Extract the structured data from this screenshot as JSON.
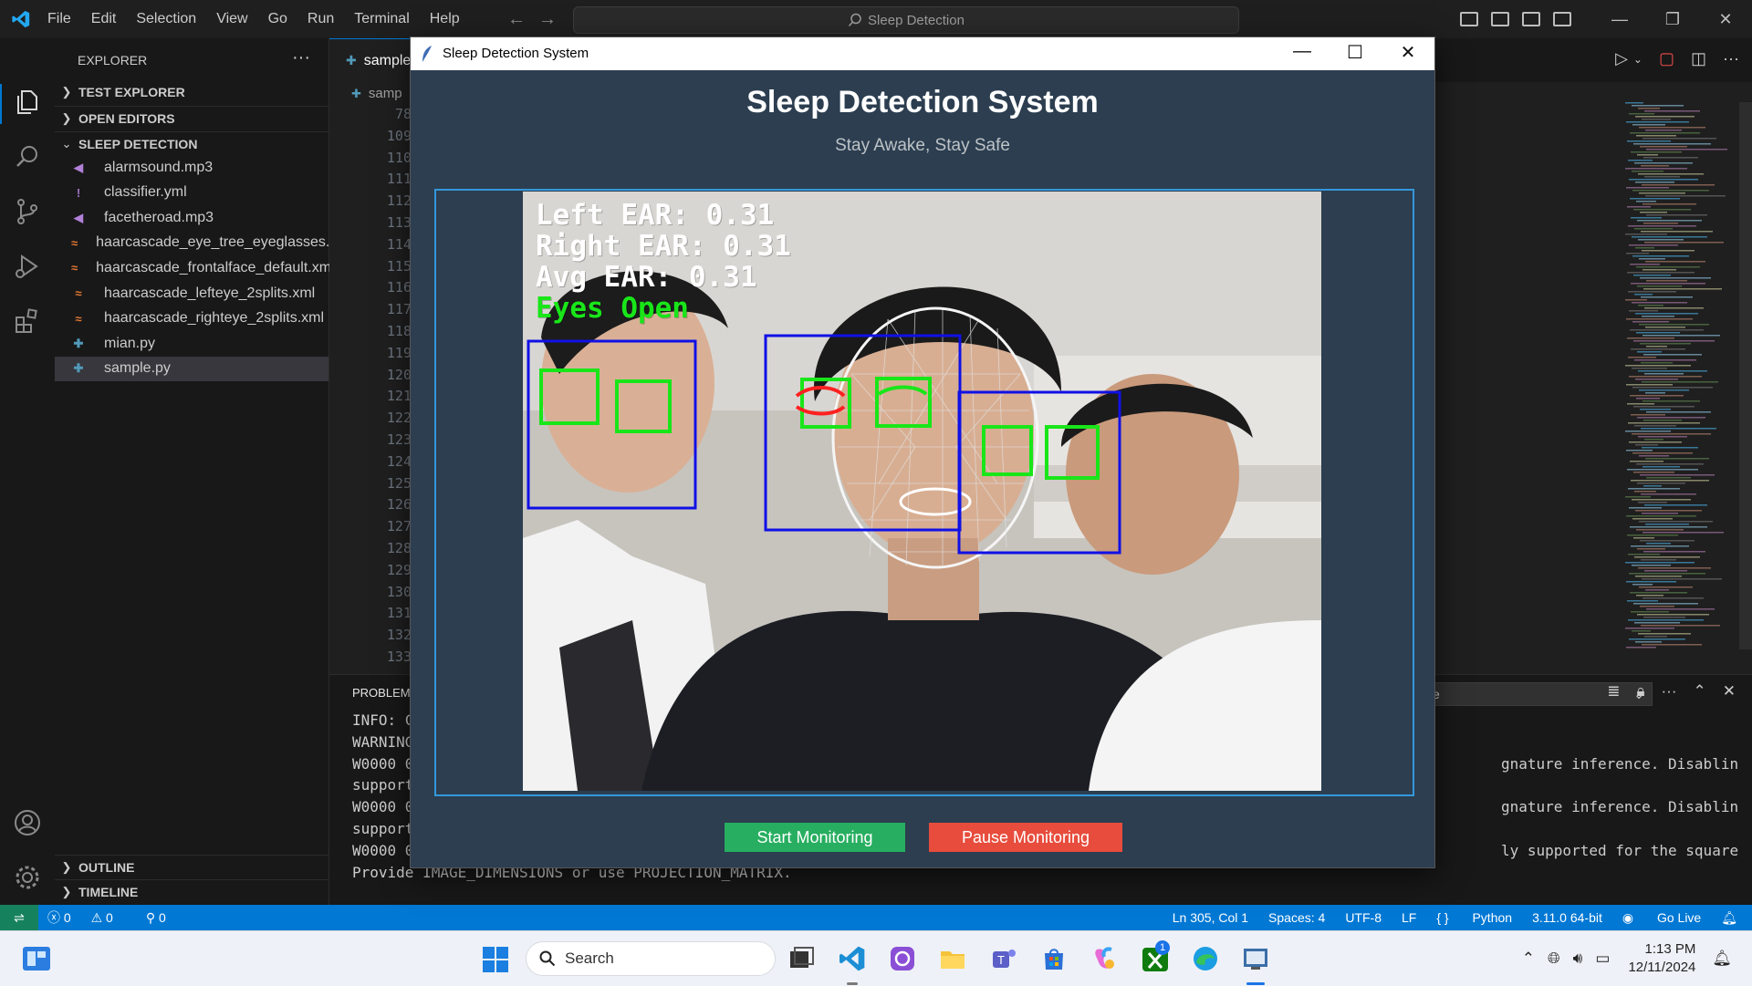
{
  "menu": [
    "File",
    "Edit",
    "Selection",
    "View",
    "Go",
    "Run",
    "Terminal",
    "Help"
  ],
  "command_center": "Sleep Detection",
  "explorer": {
    "title": "EXPLORER",
    "sections": {
      "test_explorer": "TEST EXPLORER",
      "open_editors": "OPEN EDITORS",
      "project": "SLEEP DETECTION",
      "outline": "OUTLINE",
      "timeline": "TIMELINE"
    },
    "files": [
      {
        "name": "alarmsound.mp3",
        "icon": "audio-icon",
        "glyph": "◀",
        "color": "#b180d7"
      },
      {
        "name": "classifier.yml",
        "icon": "yaml-icon",
        "glyph": "!",
        "color": "#a074c4"
      },
      {
        "name": "facetheroad.mp3",
        "icon": "audio-icon",
        "glyph": "◀",
        "color": "#b180d7"
      },
      {
        "name": "haarcascade_eye_tree_eyeglasses....",
        "icon": "rss-icon",
        "glyph": "≈",
        "color": "#e37933"
      },
      {
        "name": "haarcascade_frontalface_default.xml",
        "icon": "rss-icon",
        "glyph": "≈",
        "color": "#e37933"
      },
      {
        "name": "haarcascade_lefteye_2splits.xml",
        "icon": "rss-icon",
        "glyph": "≈",
        "color": "#e37933"
      },
      {
        "name": "haarcascade_righteye_2splits.xml",
        "icon": "rss-icon",
        "glyph": "≈",
        "color": "#e37933"
      },
      {
        "name": "mian.py",
        "icon": "python-icon",
        "glyph": "✚",
        "color": "#519aba"
      },
      {
        "name": "sample.py",
        "icon": "python-icon",
        "glyph": "✚",
        "color": "#519aba"
      }
    ]
  },
  "editor": {
    "tab": "sample",
    "breadcrumb": "samp",
    "line_numbers": [
      "78",
      "109",
      "110",
      "111",
      "112",
      "113",
      "114",
      "115",
      "116",
      "117",
      "118",
      "119",
      "120",
      "121",
      "122",
      "123",
      "124",
      "125",
      "126",
      "127",
      "128",
      "129",
      "130",
      "131",
      "132",
      "133"
    ]
  },
  "panel": {
    "tab": "PROBLEMS",
    "dropdown": "e",
    "terminal_left": [
      "INFO: C",
      "WARNING",
      "W0000 0",
      "support",
      "W0000 0",
      "support",
      "W0000 0",
      "Provide IMAGE_DIMENSIONS or use PROJECTION_MATRIX."
    ],
    "terminal_right": [
      "",
      "",
      "gnature inference. Disabling",
      "",
      "gnature inference. Disabling",
      "",
      "ly supported for the square ROI.",
      ""
    ]
  },
  "statusbar": {
    "errors": "0",
    "warnings": "0",
    "ports": "0",
    "position": "Ln 305, Col 1",
    "spaces": "Spaces: 4",
    "encoding": "UTF-8",
    "eol": "LF",
    "language": "Python",
    "interpreter": "3.11.0 64-bit",
    "golive": "Go Live"
  },
  "app": {
    "window_title": "Sleep Detection System",
    "heading": "Sleep Detection System",
    "subtitle": "Stay Awake, Stay Safe",
    "overlay": {
      "left_ear": "Left EAR: 0.31",
      "right_ear": "Right EAR: 0.31",
      "avg_ear": "Avg EAR: 0.31",
      "status": "Eyes Open"
    },
    "start_button": "Start Monitoring",
    "pause_button": "Pause Monitoring",
    "colors": {
      "bg": "#2c3e50",
      "start": "#27ae60",
      "pause": "#e74c3c",
      "frame": "#3498db",
      "eyes_open": "#19e619"
    }
  },
  "taskbar": {
    "search_placeholder": "Search",
    "time": "1:13 PM",
    "date": "12/11/2024",
    "xbox_badge": "1"
  }
}
